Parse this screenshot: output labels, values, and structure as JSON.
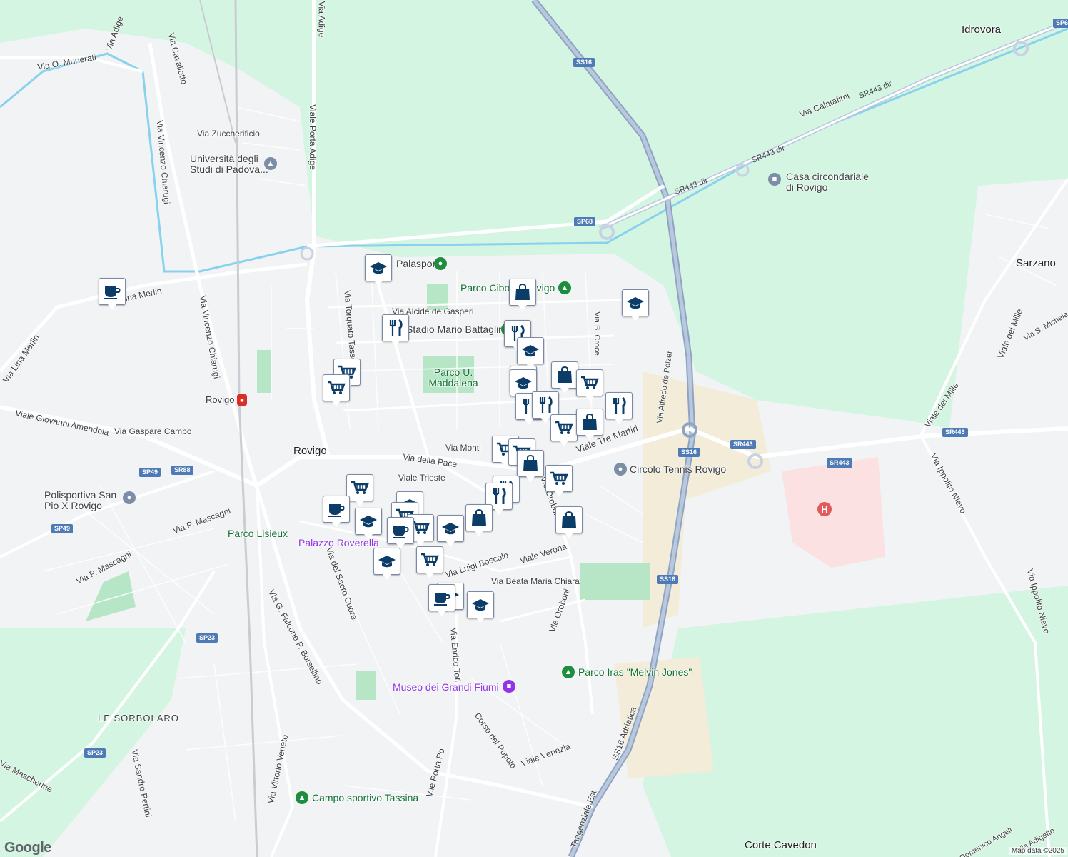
{
  "map": {
    "attribution": "Map data ©2025",
    "logo": "Google",
    "colors": {
      "land": "#f1f3f4",
      "green_area": "#d4f5e1",
      "park": "#b7e6c6",
      "water": "#89d2ee",
      "highway": "#8ea4c4",
      "road": "#ffffff",
      "hospital_area": "#fbe1e1",
      "sand_area": "#f2ecd9",
      "pin_icon": "#0c3d69"
    },
    "places": {
      "city": "Rovigo",
      "idrovora": "Idrovora",
      "sarzano": "Sarzano",
      "corte_cavedon": "Corte Cavedon",
      "le_sorbolaro": "LE SORBOLARO"
    },
    "pois": {
      "university": "Università degli Studi di Padova...",
      "palasport": "Palasport",
      "parco_cibotto": "Parco Cibotto Rovigo",
      "stadio": "Stadio Mario Battaglini",
      "parco_maddalena": "Parco U. Maddalena",
      "casa": "Casa circondariale di Rovigo",
      "circolo_tennis": "Circolo Tennis Rovigo",
      "polisportiva": "Polisportiva San Pio X Rovigo",
      "parco_lisieux": "Parco Lisieux",
      "palazzo_roverella": "Palazzo Roverella",
      "museo": "Museo dei Grandi Fiumi",
      "parco_iras": "Parco Iras \"Melvin Jones\"",
      "campo_tassina": "Campo sportivo Tassina",
      "rovigo_station": "Rovigo"
    },
    "streets": {
      "via_adige": "Via Adige",
      "viale_porta_adige_top": "Viale Porta Adige",
      "via_munerati": "Via O. Munerati",
      "via_cavalletto": "Via Cavalletto",
      "via_chiarugi_top": "Via Vincenzo Chiarugi",
      "via_zuccherificio": "Via Zuccherificio",
      "viale_porta_adige": "Viale Porta Adige",
      "via_lina_merlin": "Via Lina Merlin",
      "via_lina_merlin2": "Via Lina Merlin",
      "via_chiarugi": "Via Vincenzo Chiarugi",
      "via_torquato_tasso": "Via Torquato Tasso",
      "via_de_gasperi": "Via Alcide de Gasperi",
      "viale_amendola": "Viale Giovanni Amendola",
      "via_gaspare_campo": "Via Gaspare Campo",
      "via_monti": "Via Monti",
      "via_della_pace": "Via della Pace",
      "viale_tre_martiri": "Viale Tre Martiri",
      "viale_trieste": "Viale Trieste",
      "via_mascagni": "Via P. Mascagni",
      "via_mascagni2": "Via P. Mascagni",
      "via_sacro_cuore": "Via del Sacro Cuore",
      "via_luigi_boscolo": "Via Luigi Boscolo",
      "viale_verona": "Viale Verona",
      "via_beata_maria_chiara": "Via Beata Maria Chiara",
      "vle_oroboni": "Vle Oroboni",
      "vle_oroboni2": "Vle Oroboni",
      "via_falcone": "Via G. Falcone P. Borsellino",
      "via_enrico_toti": "Via Enrico Toti",
      "corso_del_popolo": "Corso del Popolo",
      "viale_venezia": "Viale Venezia",
      "via_vittorio_veneto": "Via Vittorio Veneto",
      "vle_porta_po": "V.le Porta Po",
      "via_sandro_pertini": "Via Sandro Pertini",
      "via_mascherine": "Via Mascherine",
      "via_calatafimi": "Via Calatafimi",
      "via_alfredo_de_polzer": "Via Alfredo de Polzer",
      "via_b_croce": "Via B. Croce",
      "viale_dei_mille": "Viale dei Mille",
      "viale_dei_mille2": "Viale dei Mille",
      "via_ippolito_nievo": "Via Ippolito Nievo",
      "via_ippolito_nievo2": "Via Ippolito Nievo",
      "via_s_michele": "Via S. Michele",
      "ss16_adriatica": "SS16 Adriatica",
      "tangenziale_est": "Tangenziale Est",
      "via_adigetto": "Via Adigetto",
      "via_domenico_angeli": "Domenico Angeli"
    },
    "shields": {
      "ss16_a": "SS16",
      "sp68": "SP68",
      "sr443dir_a": "SR443 dir",
      "sr443dir_b": "SR443 dir",
      "sr443dir_c": "SR443 dir",
      "ss16_b": "SS16",
      "sr443_a": "SR443",
      "sr443_b": "SR443",
      "sr443_c": "SR443",
      "ss16_c": "SS16",
      "sp49_a": "SP49",
      "sr88": "SR88",
      "sp49_b": "SP49",
      "sp23_a": "SP23",
      "sp23_b": "SP23",
      "sp6": "SP6"
    }
  }
}
